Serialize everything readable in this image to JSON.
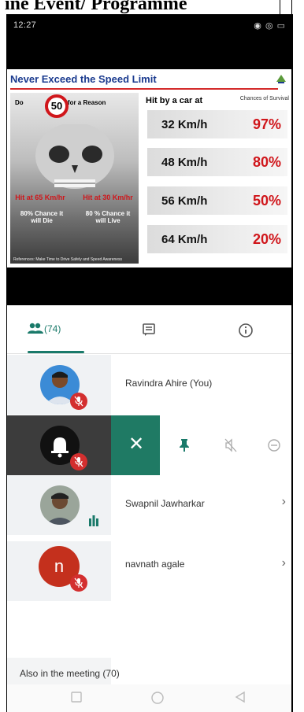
{
  "page_header": {
    "text": "ine Event/ Programme"
  },
  "status_bar": {
    "time": "12:27",
    "signal": "᯾ ⁞ ▮",
    "right_icons": "◉ ◎ ▭"
  },
  "slide": {
    "title": "Never Exceed the Speed Limit",
    "poster": {
      "top_left": "Do",
      "sign": "50",
      "top_right": "for a Reason",
      "left_red": "Hit at 65 Km/hr",
      "right_red": "Hit at 30 Km/hr",
      "left_white": "80% Chance it will Die",
      "right_white": "80 % Chance it will Live",
      "footnote": "References: Make Time to Drive Safely and Speed Awareness"
    },
    "table_header": "Hit by a car at",
    "table_header_right": "Chances of Survival",
    "rows": [
      {
        "speed": "32 Km/h",
        "survival": "97%"
      },
      {
        "speed": "48 Km/h",
        "survival": "80%"
      },
      {
        "speed": "56 Km/h",
        "survival": "50%"
      },
      {
        "speed": "64 Km/h",
        "survival": "20%"
      }
    ]
  },
  "tabs": {
    "people_count": "(74)"
  },
  "participants": [
    {
      "name": "Ravindra Ahire (You)"
    },
    {
      "name": ""
    },
    {
      "name": "Swapnil Jawharkar"
    },
    {
      "name": "navnath agale",
      "initial": "n"
    }
  ],
  "also_in_meeting": "Also in the meeting (70)",
  "colors": {
    "accent": "#1a7a6a",
    "mute_red": "#d32f2f",
    "slide_title": "#1b3b8f"
  }
}
